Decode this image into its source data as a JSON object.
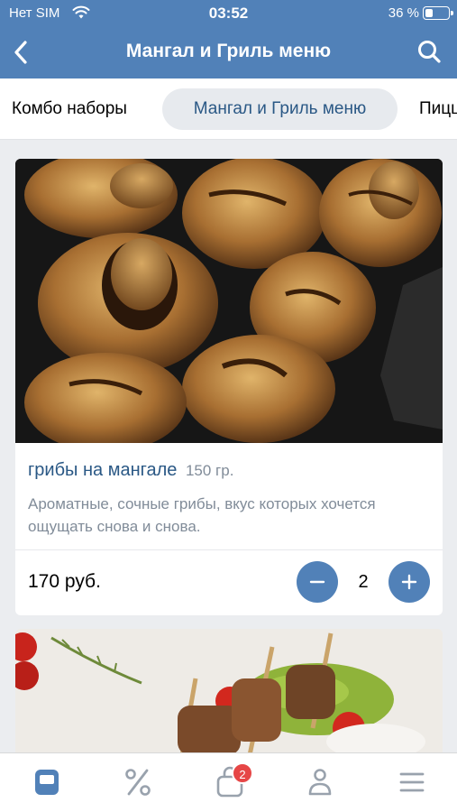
{
  "status_bar": {
    "carrier": "Нет SIM",
    "time": "03:52",
    "battery_percent": "36 %",
    "battery_level": 0.36
  },
  "header": {
    "title": "Мангал и Гриль меню",
    "back_icon": "chevron-left-icon",
    "search_icon": "search-icon"
  },
  "tabs": [
    {
      "label": "Комбо наборы",
      "active": false
    },
    {
      "label": "Мангал и Гриль меню",
      "active": true
    },
    {
      "label": "Пицца",
      "active": false
    }
  ],
  "product": {
    "name": "грибы на мангале",
    "weight": "150 гр.",
    "description": "Ароматные, сочные грибы, вкус которых хочется ощущать снова и снова.",
    "price": "170 руб.",
    "quantity": "2"
  },
  "bottom_nav": {
    "items": [
      {
        "icon": "menu-book-icon",
        "active": true
      },
      {
        "icon": "percent-icon",
        "active": false
      },
      {
        "icon": "cart-icon",
        "active": false,
        "badge": "2"
      },
      {
        "icon": "profile-icon",
        "active": false
      },
      {
        "icon": "hamburger-icon",
        "active": false
      }
    ]
  },
  "colors": {
    "accent": "#5181b8",
    "link": "#2a5885",
    "secondary_text": "#818c99",
    "badge": "#e64646"
  }
}
